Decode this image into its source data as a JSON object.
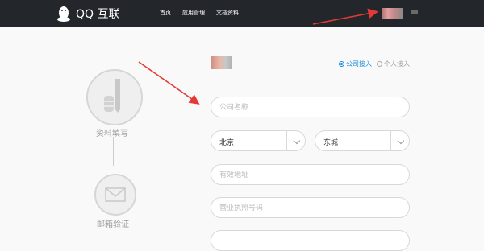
{
  "header": {
    "logo_text": "QQ 互联",
    "nav": [
      "首页",
      "应用管理",
      "文档资料"
    ]
  },
  "steps": [
    {
      "label": "资料填写"
    },
    {
      "label": "邮箱验证"
    }
  ],
  "form": {
    "account_type": {
      "options": [
        "公司接入",
        "个人接入"
      ],
      "selected": "公司接入"
    },
    "company_name": {
      "placeholder": "公司名称"
    },
    "province": {
      "value": "北京"
    },
    "city": {
      "value": "东城"
    },
    "address": {
      "placeholder": "有效地址"
    },
    "license": {
      "placeholder": "营业执照号码"
    }
  },
  "colors": {
    "header_bg": "#23262b",
    "accent": "#1a8cdb",
    "annotation_arrow": "#e53935"
  }
}
